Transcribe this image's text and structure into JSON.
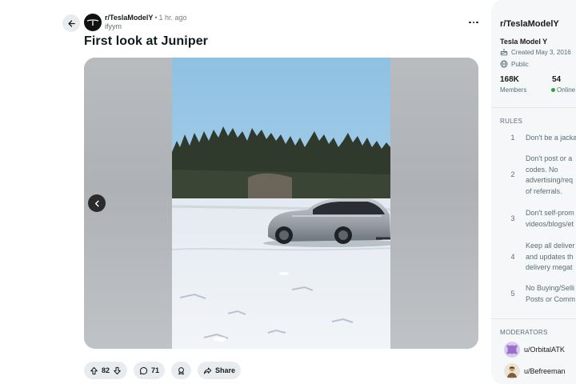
{
  "post": {
    "subreddit": "r/TeslaModelY",
    "time": "1 hr. ago",
    "author": "ifyym",
    "title": "First look at Juniper",
    "upvotes": "82",
    "comments": "71",
    "share_label": "Share",
    "gallery": {
      "total": 3,
      "active_index": 2
    }
  },
  "sidebar": {
    "title": "r/TeslaModelY",
    "community_name": "Tesla Model Y",
    "created": "Created May 3, 2016",
    "visibility": "Public",
    "members_count": "168K",
    "members_label": "Members",
    "online_count": "54",
    "online_label": "Online",
    "rules_heading": "RULES",
    "rules": [
      {
        "num": "1",
        "text": "Don't be a jacka"
      },
      {
        "num": "2",
        "text": "Don't post or a\ncodes. No\nadvertising/req\nof referrals."
      },
      {
        "num": "3",
        "text": "Don't self-prom\nvideos/blogs/et"
      },
      {
        "num": "4",
        "text": "Keep all deliver\nand updates th\ndelivery megat"
      },
      {
        "num": "5",
        "text": "No Buying/Selli\nPosts or Comm"
      }
    ],
    "moderators_heading": "MODERATORS",
    "moderators": [
      {
        "name": "u/OrbitalATK"
      },
      {
        "name": "u/Befreeman"
      }
    ]
  },
  "colors": {
    "pill_bg": "#e9ecef",
    "sidebar_bg": "#f6f7f8",
    "online": "#2aa33e"
  }
}
